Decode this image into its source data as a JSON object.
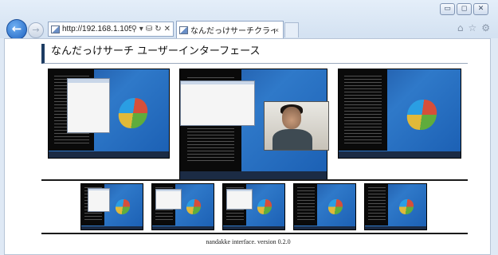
{
  "browser": {
    "url": "http://192.168.1.105",
    "address_icons": [
      "⚲ ▾",
      "⛁",
      "↻",
      "✕"
    ],
    "tab_title": "なんだっけサーチクライ...",
    "tab_close": "×",
    "back_glyph": "←",
    "forward_glyph": "→",
    "window_buttons": [
      "▭",
      "◻",
      "✕"
    ],
    "toolbar_icons": [
      "⌂",
      "☆",
      "⚙"
    ]
  },
  "page": {
    "title": "なんだっけサーチ ユーザーインターフェース",
    "footer": "nandakke interface. version 0.2.0"
  },
  "colors": {
    "accent_bar": "#1d3c63",
    "desktop_blue": "#2f79c9"
  },
  "icons": [
    "back-arrow-icon",
    "forward-arrow-icon",
    "search-icon",
    "refresh-icon",
    "stop-icon",
    "home-icon",
    "favorites-star-icon",
    "settings-gear-icon"
  ]
}
